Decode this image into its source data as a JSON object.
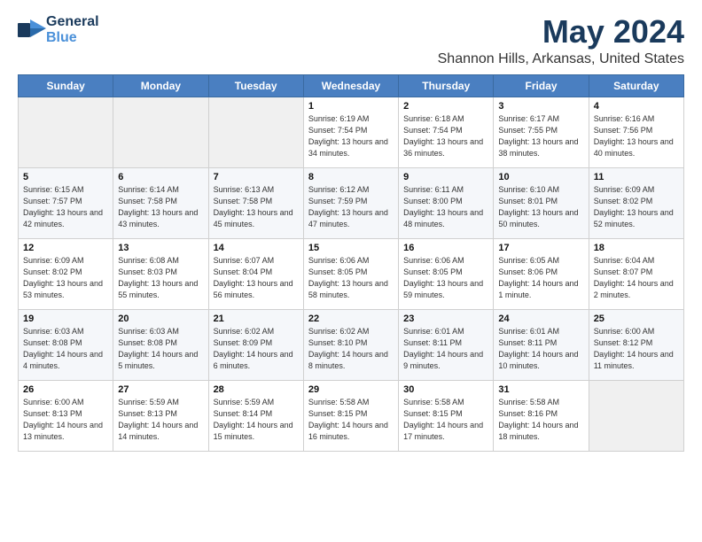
{
  "logo": {
    "line1": "General",
    "line2": "Blue"
  },
  "title": "May 2024",
  "location": "Shannon Hills, Arkansas, United States",
  "weekdays": [
    "Sunday",
    "Monday",
    "Tuesday",
    "Wednesday",
    "Thursday",
    "Friday",
    "Saturday"
  ],
  "weeks": [
    [
      {
        "day": "",
        "sunrise": "",
        "sunset": "",
        "daylight": ""
      },
      {
        "day": "",
        "sunrise": "",
        "sunset": "",
        "daylight": ""
      },
      {
        "day": "",
        "sunrise": "",
        "sunset": "",
        "daylight": ""
      },
      {
        "day": "1",
        "sunrise": "Sunrise: 6:19 AM",
        "sunset": "Sunset: 7:54 PM",
        "daylight": "Daylight: 13 hours and 34 minutes."
      },
      {
        "day": "2",
        "sunrise": "Sunrise: 6:18 AM",
        "sunset": "Sunset: 7:54 PM",
        "daylight": "Daylight: 13 hours and 36 minutes."
      },
      {
        "day": "3",
        "sunrise": "Sunrise: 6:17 AM",
        "sunset": "Sunset: 7:55 PM",
        "daylight": "Daylight: 13 hours and 38 minutes."
      },
      {
        "day": "4",
        "sunrise": "Sunrise: 6:16 AM",
        "sunset": "Sunset: 7:56 PM",
        "daylight": "Daylight: 13 hours and 40 minutes."
      }
    ],
    [
      {
        "day": "5",
        "sunrise": "Sunrise: 6:15 AM",
        "sunset": "Sunset: 7:57 PM",
        "daylight": "Daylight: 13 hours and 42 minutes."
      },
      {
        "day": "6",
        "sunrise": "Sunrise: 6:14 AM",
        "sunset": "Sunset: 7:58 PM",
        "daylight": "Daylight: 13 hours and 43 minutes."
      },
      {
        "day": "7",
        "sunrise": "Sunrise: 6:13 AM",
        "sunset": "Sunset: 7:58 PM",
        "daylight": "Daylight: 13 hours and 45 minutes."
      },
      {
        "day": "8",
        "sunrise": "Sunrise: 6:12 AM",
        "sunset": "Sunset: 7:59 PM",
        "daylight": "Daylight: 13 hours and 47 minutes."
      },
      {
        "day": "9",
        "sunrise": "Sunrise: 6:11 AM",
        "sunset": "Sunset: 8:00 PM",
        "daylight": "Daylight: 13 hours and 48 minutes."
      },
      {
        "day": "10",
        "sunrise": "Sunrise: 6:10 AM",
        "sunset": "Sunset: 8:01 PM",
        "daylight": "Daylight: 13 hours and 50 minutes."
      },
      {
        "day": "11",
        "sunrise": "Sunrise: 6:09 AM",
        "sunset": "Sunset: 8:02 PM",
        "daylight": "Daylight: 13 hours and 52 minutes."
      }
    ],
    [
      {
        "day": "12",
        "sunrise": "Sunrise: 6:09 AM",
        "sunset": "Sunset: 8:02 PM",
        "daylight": "Daylight: 13 hours and 53 minutes."
      },
      {
        "day": "13",
        "sunrise": "Sunrise: 6:08 AM",
        "sunset": "Sunset: 8:03 PM",
        "daylight": "Daylight: 13 hours and 55 minutes."
      },
      {
        "day": "14",
        "sunrise": "Sunrise: 6:07 AM",
        "sunset": "Sunset: 8:04 PM",
        "daylight": "Daylight: 13 hours and 56 minutes."
      },
      {
        "day": "15",
        "sunrise": "Sunrise: 6:06 AM",
        "sunset": "Sunset: 8:05 PM",
        "daylight": "Daylight: 13 hours and 58 minutes."
      },
      {
        "day": "16",
        "sunrise": "Sunrise: 6:06 AM",
        "sunset": "Sunset: 8:05 PM",
        "daylight": "Daylight: 13 hours and 59 minutes."
      },
      {
        "day": "17",
        "sunrise": "Sunrise: 6:05 AM",
        "sunset": "Sunset: 8:06 PM",
        "daylight": "Daylight: 14 hours and 1 minute."
      },
      {
        "day": "18",
        "sunrise": "Sunrise: 6:04 AM",
        "sunset": "Sunset: 8:07 PM",
        "daylight": "Daylight: 14 hours and 2 minutes."
      }
    ],
    [
      {
        "day": "19",
        "sunrise": "Sunrise: 6:03 AM",
        "sunset": "Sunset: 8:08 PM",
        "daylight": "Daylight: 14 hours and 4 minutes."
      },
      {
        "day": "20",
        "sunrise": "Sunrise: 6:03 AM",
        "sunset": "Sunset: 8:08 PM",
        "daylight": "Daylight: 14 hours and 5 minutes."
      },
      {
        "day": "21",
        "sunrise": "Sunrise: 6:02 AM",
        "sunset": "Sunset: 8:09 PM",
        "daylight": "Daylight: 14 hours and 6 minutes."
      },
      {
        "day": "22",
        "sunrise": "Sunrise: 6:02 AM",
        "sunset": "Sunset: 8:10 PM",
        "daylight": "Daylight: 14 hours and 8 minutes."
      },
      {
        "day": "23",
        "sunrise": "Sunrise: 6:01 AM",
        "sunset": "Sunset: 8:11 PM",
        "daylight": "Daylight: 14 hours and 9 minutes."
      },
      {
        "day": "24",
        "sunrise": "Sunrise: 6:01 AM",
        "sunset": "Sunset: 8:11 PM",
        "daylight": "Daylight: 14 hours and 10 minutes."
      },
      {
        "day": "25",
        "sunrise": "Sunrise: 6:00 AM",
        "sunset": "Sunset: 8:12 PM",
        "daylight": "Daylight: 14 hours and 11 minutes."
      }
    ],
    [
      {
        "day": "26",
        "sunrise": "Sunrise: 6:00 AM",
        "sunset": "Sunset: 8:13 PM",
        "daylight": "Daylight: 14 hours and 13 minutes."
      },
      {
        "day": "27",
        "sunrise": "Sunrise: 5:59 AM",
        "sunset": "Sunset: 8:13 PM",
        "daylight": "Daylight: 14 hours and 14 minutes."
      },
      {
        "day": "28",
        "sunrise": "Sunrise: 5:59 AM",
        "sunset": "Sunset: 8:14 PM",
        "daylight": "Daylight: 14 hours and 15 minutes."
      },
      {
        "day": "29",
        "sunrise": "Sunrise: 5:58 AM",
        "sunset": "Sunset: 8:15 PM",
        "daylight": "Daylight: 14 hours and 16 minutes."
      },
      {
        "day": "30",
        "sunrise": "Sunrise: 5:58 AM",
        "sunset": "Sunset: 8:15 PM",
        "daylight": "Daylight: 14 hours and 17 minutes."
      },
      {
        "day": "31",
        "sunrise": "Sunrise: 5:58 AM",
        "sunset": "Sunset: 8:16 PM",
        "daylight": "Daylight: 14 hours and 18 minutes."
      },
      {
        "day": "",
        "sunrise": "",
        "sunset": "",
        "daylight": ""
      }
    ]
  ]
}
